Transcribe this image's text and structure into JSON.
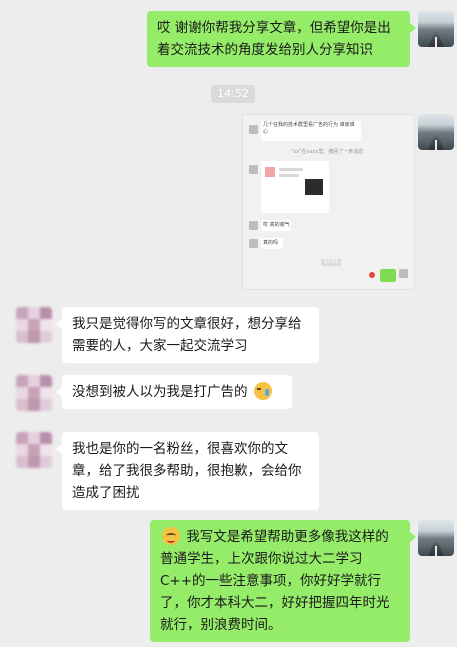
{
  "messages": [
    {
      "id": "m1",
      "side": "out",
      "text": "哎 谢谢你帮我分享文章，但希望你是出着交流技术的角度发给别人分享知识"
    },
    {
      "id": "time1",
      "text": "14:52"
    },
    {
      "id": "m2",
      "side": "out",
      "type": "screenshot",
      "mini": {
        "line1": "几个在我的技术群里看广告的行为 谁家谁心",
        "line2": "\"xx\"在xxxx里，撤回了一条消息",
        "reply1": "哎 真的谢气",
        "reply2": "真的吗",
        "time": "14:51"
      }
    },
    {
      "id": "m3",
      "side": "in",
      "text": "我只是觉得你写的文章很好，想分享给需要的人，大家一起交流学习"
    },
    {
      "id": "m4",
      "side": "in",
      "text": "没想到被人以为我是打广告的"
    },
    {
      "id": "m5",
      "side": "in",
      "text": "我也是你的一名粉丝，很喜欢你的文章，给了我很多帮助，很抱歉，会给你造成了困扰"
    },
    {
      "id": "m6",
      "side": "out",
      "text": "我写文是希望帮助更多像我这样的普通学生，上次跟你说过大二学习C++的一些注意事项，你好好学就行了，你才本科大二，好好把握四年时光就行，别浪费时间。"
    }
  ],
  "icons": {
    "emoji_cry": "crying-face-icon",
    "emoji_smile": "smiling-face-icon"
  },
  "colors": {
    "outgoing": "#95ec69",
    "incoming": "#ffffff",
    "background": "#ededed"
  }
}
